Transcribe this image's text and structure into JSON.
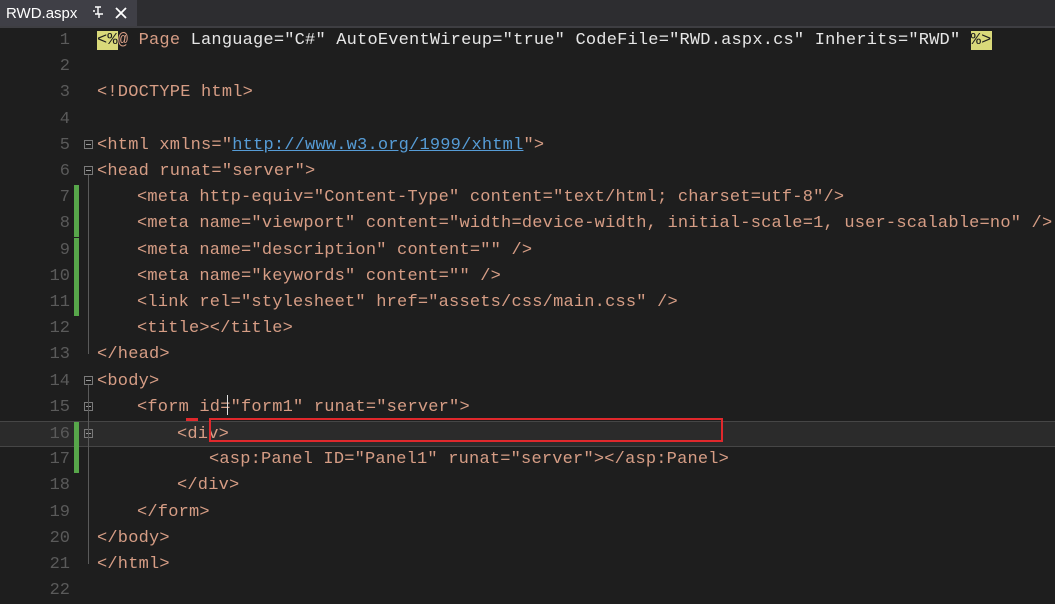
{
  "tab": {
    "title": "RWD.aspx",
    "pin_icon": "pin-icon",
    "close_icon": "close-icon"
  },
  "colors": {
    "background": "#1e1e1e",
    "tag": "#d69d85",
    "change_marker": "#57a64a",
    "highlight_box": "#e0282c",
    "link": "#569cd6"
  },
  "lines": [
    {
      "n": "1"
    },
    {
      "n": "2"
    },
    {
      "n": "3"
    },
    {
      "n": "4"
    },
    {
      "n": "5"
    },
    {
      "n": "6"
    },
    {
      "n": "7"
    },
    {
      "n": "8"
    },
    {
      "n": "9"
    },
    {
      "n": "10"
    },
    {
      "n": "11"
    },
    {
      "n": "12"
    },
    {
      "n": "13"
    },
    {
      "n": "14"
    },
    {
      "n": "15"
    },
    {
      "n": "16"
    },
    {
      "n": "17"
    },
    {
      "n": "18"
    },
    {
      "n": "19"
    },
    {
      "n": "20"
    },
    {
      "n": "21"
    },
    {
      "n": "22"
    }
  ],
  "code": {
    "l1_open": "<%",
    "l1_page": "@ Page ",
    "l1_attrs": "Language=\"C#\" AutoEventWireup=\"true\" CodeFile=\"RWD.aspx.cs\" Inherits=\"RWD\" ",
    "l1_close": "%>",
    "l3": "<!DOCTYPE html>",
    "l5_a": "<html xmlns=\"",
    "l5_link": "http://www.w3.org/1999/xhtml",
    "l5_b": "\">",
    "l6": "<head runat=\"server\">",
    "l7": "<meta http-equiv=\"Content-Type\" content=\"text/html; charset=utf-8\"/>",
    "l8": "<meta name=\"viewport\" content=\"width=device-width, initial-scale=1, user-scalable=no\" />",
    "l9": "<meta name=\"description\" content=\"\" />",
    "l10": "<meta name=\"keywords\" content=\"\" />",
    "l11": "<link rel=\"stylesheet\" href=\"assets/css/main.css\" />",
    "l12": "<title></title>",
    "l13": "</head>",
    "l14": "<body>",
    "l15": "<form id=\"form1\" runat=\"server\">",
    "l16": "<div>",
    "l17": "<asp:Panel ID=\"Panel1\" runat=\"server\"></asp:Panel>",
    "l18": "</div>",
    "l19": "</form>",
    "l20": "</body>",
    "l21": "</html>"
  }
}
